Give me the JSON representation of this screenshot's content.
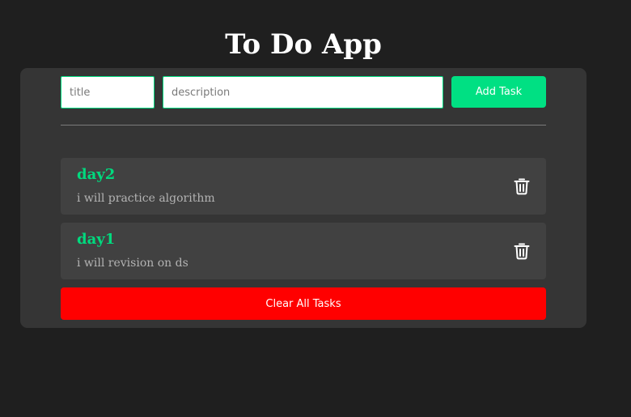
{
  "app": {
    "title": "To Do App"
  },
  "form": {
    "title_placeholder": "title",
    "title_value": "",
    "description_placeholder": "description",
    "description_value": "",
    "add_label": "Add Task"
  },
  "tasks": [
    {
      "title": "day2",
      "description": "i will practice algorithm",
      "delete_icon": "trash-icon"
    },
    {
      "title": "day1",
      "description": "i will revision on ds",
      "delete_icon": "trash-icon"
    }
  ],
  "actions": {
    "clear_label": "Clear All Tasks"
  },
  "colors": {
    "background": "#1f1f1f",
    "panel": "#353535",
    "task_card": "#414141",
    "accent": "#00e083",
    "danger": "#ff0000"
  }
}
